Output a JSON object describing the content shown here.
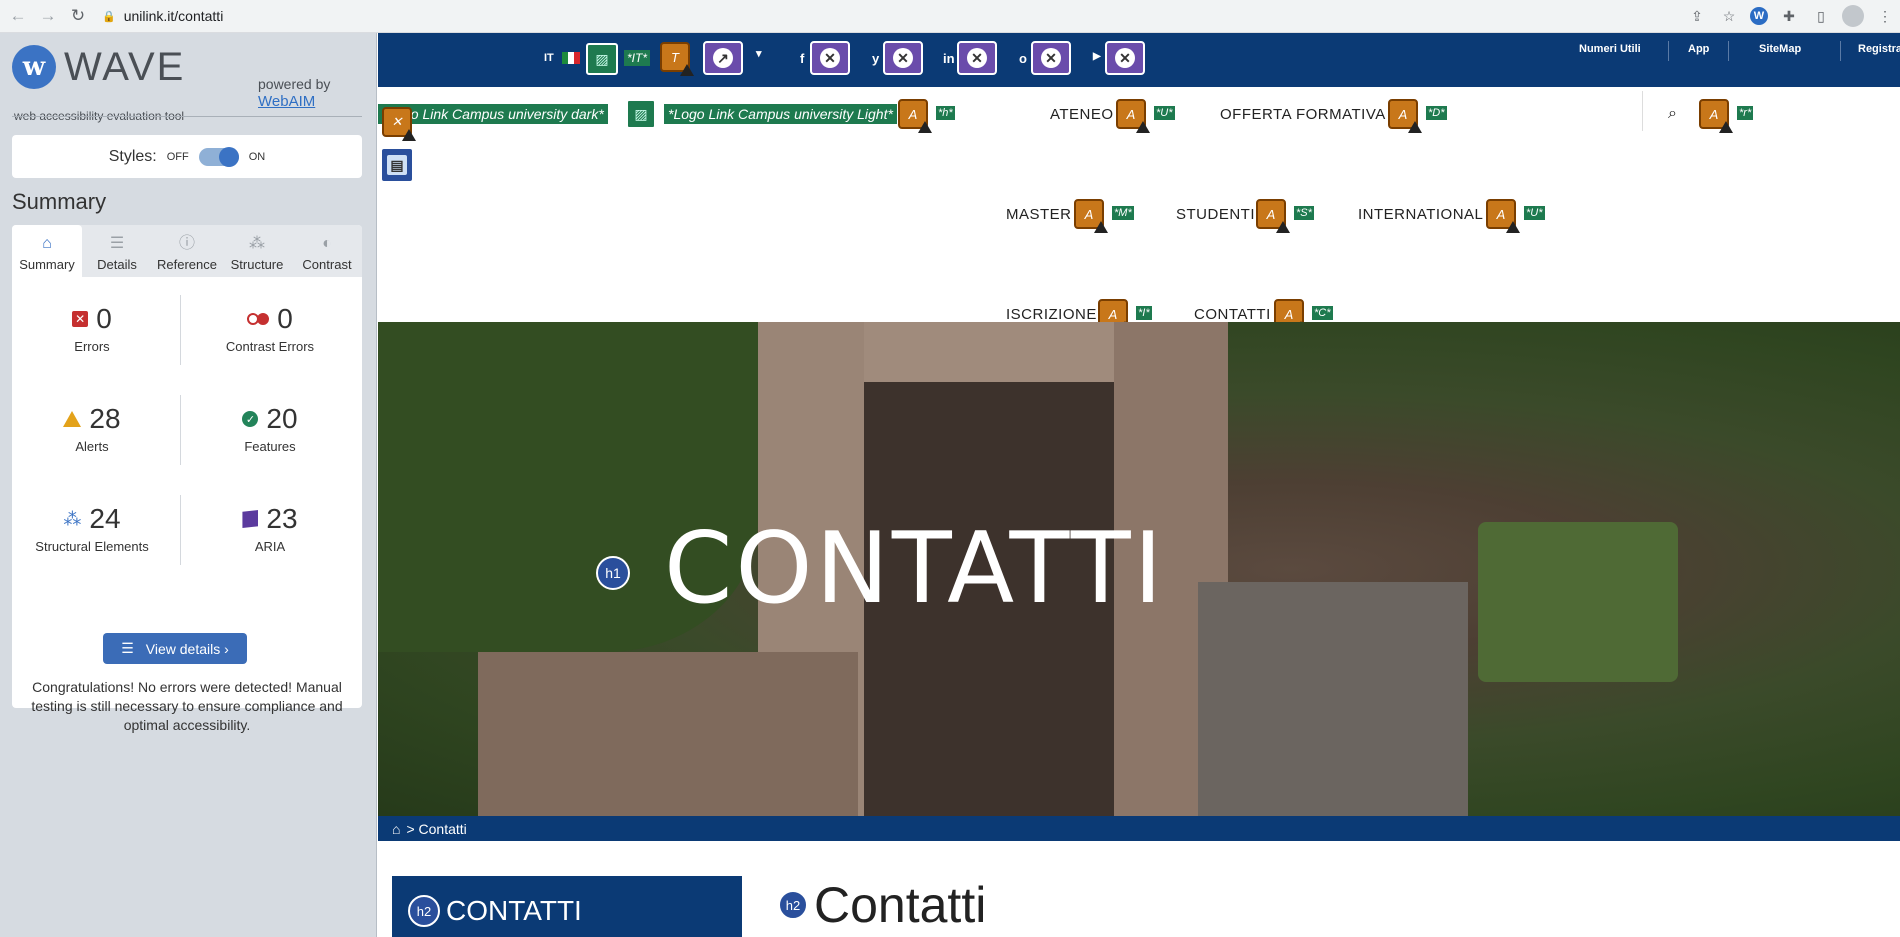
{
  "browser": {
    "url": "unilink.it/contatti"
  },
  "wave": {
    "title": "WAVE",
    "tagline": "web accessibility evaluation tool",
    "powered_by": "powered by",
    "webaim": "WebAIM",
    "styles_label": "Styles:",
    "styles_off": "OFF",
    "styles_on": "ON",
    "summary_heading": "Summary",
    "tabs": [
      {
        "label": "Summary",
        "icon": "home-icon"
      },
      {
        "label": "Details",
        "icon": "list-icon"
      },
      {
        "label": "Reference",
        "icon": "info-icon"
      },
      {
        "label": "Structure",
        "icon": "sitemap-icon"
      },
      {
        "label": "Contrast",
        "icon": "contrast-icon"
      }
    ],
    "stats": {
      "errors": {
        "value": "0",
        "label": "Errors"
      },
      "contrast_errors": {
        "value": "0",
        "label": "Contrast Errors"
      },
      "alerts": {
        "value": "28",
        "label": "Alerts"
      },
      "features": {
        "value": "20",
        "label": "Features"
      },
      "structural": {
        "value": "24",
        "label": "Structural Elements"
      },
      "aria": {
        "value": "23",
        "label": "ARIA"
      }
    },
    "view_details": "View details ›",
    "congrats": "Congratulations! No errors were detected! Manual testing is still necessary to ensure compliance and optimal accessibility."
  },
  "site": {
    "lang": "IT",
    "lang_alt": "*IT*",
    "social": [
      "f",
      "y",
      "in",
      "o",
      "▶"
    ],
    "top_links": [
      "Numeri Utili",
      "App",
      "SiteMap",
      "Registrati"
    ],
    "logo_dark_alt": "*Logo Link Campus university dark*",
    "logo_light_alt": "*Logo Link Campus university Light*",
    "logo_h_alt": "*h*",
    "menu": [
      {
        "label": "ATENEO",
        "alt": "*U*"
      },
      {
        "label": "OFFERTA FORMATIVA",
        "alt": "*D*"
      },
      {
        "label": "MASTER",
        "alt": "*M*"
      },
      {
        "label": "STUDENTI",
        "alt": "*S*"
      },
      {
        "label": "INTERNATIONAL",
        "alt": "*U*"
      },
      {
        "label": "ISCRIZIONE",
        "alt": "*I*"
      },
      {
        "label": "CONTATTI",
        "alt": "*C*"
      }
    ],
    "search_alt": "*r*",
    "hero_title": "CONTATTI",
    "h1_badge": "h1",
    "breadcrumb": "> Contatti",
    "side_heading": "CONTATTI",
    "main_heading": "Contatti",
    "h2_badge": "h2"
  }
}
